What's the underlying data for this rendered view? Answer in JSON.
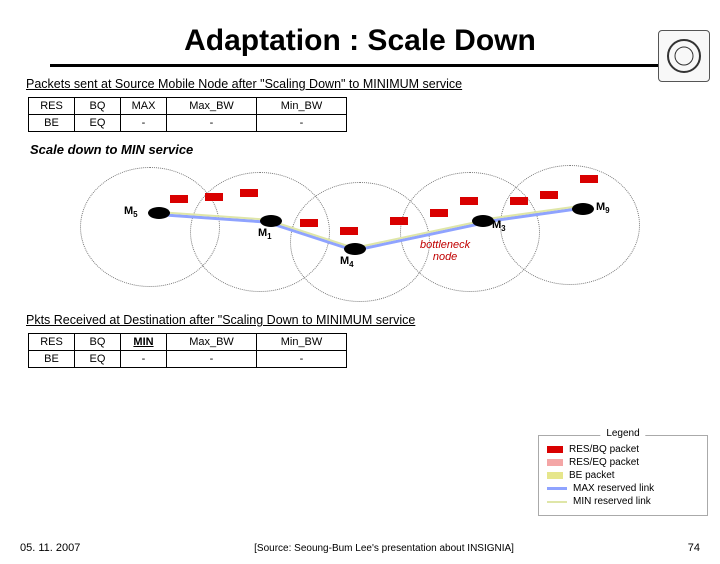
{
  "title": "Adaptation : Scale Down",
  "top_caption": "Packets sent at Source Mobile Node after \"Scaling Down\" to MINIMUM service",
  "table_top": {
    "rows": [
      [
        "RES",
        "BQ",
        "MAX",
        "Max_BW",
        "Min_BW"
      ],
      [
        "BE",
        "EQ",
        "-",
        "-",
        "-"
      ]
    ]
  },
  "diagram_caption": "Scale down to MIN service",
  "nodes": {
    "m5": "M",
    "m5_sub": "5",
    "m1": "M",
    "m1_sub": "1",
    "m4": "M",
    "m4_sub": "4",
    "m3": "M",
    "m3_sub": "3",
    "m9": "M",
    "m9_sub": "9"
  },
  "bottleneck_label": "bottleneck\nnode",
  "bottom_caption": "Pkts Received at Destination after \"Scaling Down to MINIMUM service",
  "table_bottom": {
    "rows": [
      [
        "RES",
        "BQ",
        "MIN",
        "Max_BW",
        "Min_BW"
      ],
      [
        "BE",
        "EQ",
        "-",
        "-",
        "-"
      ]
    ]
  },
  "legend": {
    "title": "Legend",
    "items": [
      {
        "k": "red",
        "t": "RES/BQ packet"
      },
      {
        "k": "lightred",
        "t": "RES/EQ packet"
      },
      {
        "k": "yellow",
        "t": "BE         packet"
      },
      {
        "k": "blue",
        "t": "MAX reserved link"
      },
      {
        "k": "olive",
        "t": "MIN reserved link"
      }
    ]
  },
  "footer": {
    "date": "05. 11. 2007",
    "source": "[Source: Seoung-Bum Lee's presentation about INSIGNIA]",
    "page": "74"
  }
}
